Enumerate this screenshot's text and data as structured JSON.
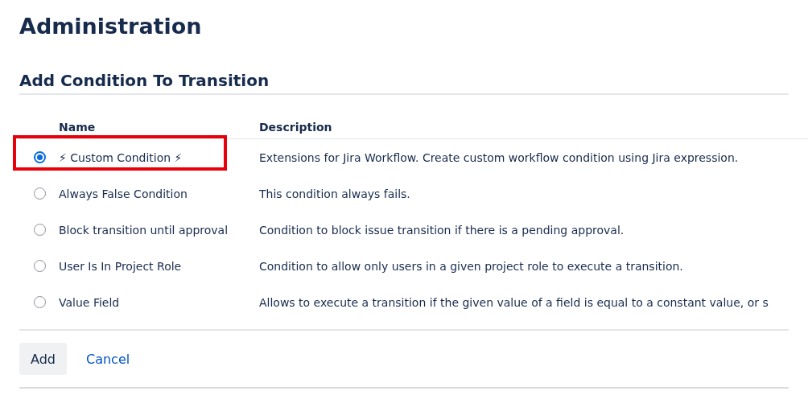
{
  "page_title": "Administration",
  "section_title": "Add Condition To Transition",
  "table": {
    "columns": [
      "Name",
      "Description"
    ],
    "rows": [
      {
        "name": "⚡ Custom Condition ⚡",
        "description": "Extensions for Jira Workflow. Create custom workflow condition using Jira expression.",
        "selected": true,
        "highlighted": true
      },
      {
        "name": "Always False Condition",
        "description": "This condition always fails.",
        "selected": false,
        "highlighted": false
      },
      {
        "name": "Block transition until approval",
        "description": "Condition to block issue transition if there is a pending approval.",
        "selected": false,
        "highlighted": false
      },
      {
        "name": "User Is In Project Role",
        "description": "Condition to allow only users in a given project role to execute a transition.",
        "selected": false,
        "highlighted": false
      },
      {
        "name": "Value Field",
        "description": "Allows to execute a transition if the given value of a field is equal to a constant value, or s",
        "selected": false,
        "highlighted": false
      }
    ]
  },
  "buttons": {
    "primary": "Add",
    "cancel": "Cancel"
  }
}
